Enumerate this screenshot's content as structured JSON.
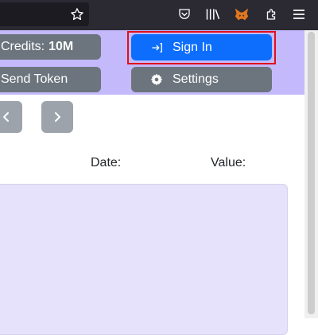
{
  "browser": {
    "toolbar_icons": [
      "star-icon",
      "pocket-icon",
      "library-icon",
      "metamask-fox-icon",
      "extensions-icon",
      "menu-icon"
    ]
  },
  "header": {
    "credits_label": "Credits:",
    "credits_value": "10M",
    "send_token_label": "Send Token",
    "sign_in_label": "Sign In",
    "settings_label": "Settings"
  },
  "pager": {
    "prev_glyph": "‹",
    "next_glyph": "›"
  },
  "fields": {
    "date_label": "Date:",
    "value_label": "Value:"
  },
  "colors": {
    "header_bg": "#c4b9fb",
    "primary": "#0d6efd",
    "secondary": "#6c757d",
    "panel_bg": "#e6e2fb",
    "highlight": "#e0101c"
  }
}
